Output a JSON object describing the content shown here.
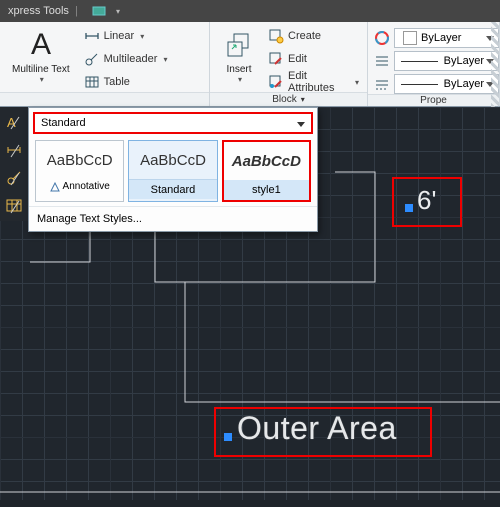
{
  "titlebar": {
    "tab": "xpress Tools",
    "layout_icon": "square-icon"
  },
  "ribbon": {
    "annotation": {
      "multiline_text": "Multiline Text",
      "linear": "Linear",
      "multileader": "Multileader",
      "table": "Table"
    },
    "block": {
      "insert": "Insert",
      "create": "Create",
      "edit": "Edit",
      "edit_attributes": "Edit Attributes",
      "label": "Block"
    },
    "properties": {
      "bylayer_color": "ByLayer",
      "bylayer_line1": "ByLayer",
      "bylayer_line2": "ByLayer",
      "label": "Prope"
    }
  },
  "styledd": {
    "current": "Standard",
    "sw1_prev": "AaBbCcD",
    "sw1_cap": "Annotative",
    "sw2_prev": "AaBbCcD",
    "sw2_cap": "Standard",
    "sw3_prev": "AaBbCcD",
    "sw3_cap": "style1",
    "manage": "Manage Text Styles..."
  },
  "canvas": {
    "dim_value": "6'",
    "outer_area": "Outer Area"
  }
}
